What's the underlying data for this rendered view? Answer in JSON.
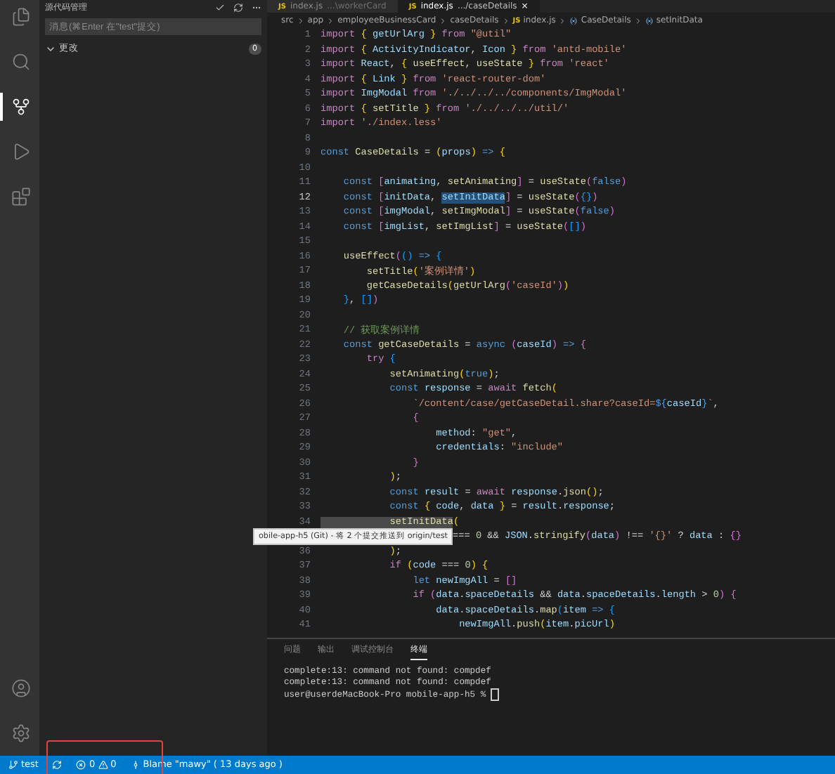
{
  "activity_bar": {
    "items": [
      {
        "kind": "files",
        "selected": false
      },
      {
        "kind": "search",
        "selected": false
      },
      {
        "kind": "scm",
        "selected": true
      },
      {
        "kind": "run",
        "selected": false
      },
      {
        "kind": "extensions",
        "selected": false
      }
    ],
    "bottom": [
      {
        "kind": "account"
      },
      {
        "kind": "settings"
      }
    ]
  },
  "sidebar": {
    "title": "源代码管理",
    "message_placeholder": "消息(⌘Enter 在\"test\"提交)",
    "section": {
      "label": "更改",
      "expanded": true,
      "count": "0"
    }
  },
  "tabs": [
    {
      "badge": "JS",
      "label": "index.js",
      "description": "...\\workerCard",
      "selected": false
    },
    {
      "badge": "JS",
      "label": "index.js",
      "description": ".../caseDetails",
      "selected": true,
      "close": "×"
    }
  ],
  "breadcrumb": [
    {
      "kind": "folder",
      "text": "src"
    },
    {
      "kind": "folder",
      "text": "app"
    },
    {
      "kind": "folder",
      "text": "employeeBusinessCard"
    },
    {
      "kind": "folder",
      "text": "caseDetails"
    },
    {
      "kind": "file",
      "badge": "JS",
      "text": "index.js"
    },
    {
      "kind": "symbol",
      "text": "CaseDetails"
    },
    {
      "kind": "symbol",
      "text": "setInitData"
    }
  ],
  "code": [
    {
      "number": "1",
      "current": false,
      "tokens": [
        {
          "kind": "kw",
          "text": "import "
        },
        {
          "kind": "br1",
          "text": "{ "
        },
        {
          "kind": "var",
          "text": "getUrlArg"
        },
        {
          "kind": "br1",
          "text": " }"
        },
        {
          "kind": "kw",
          "text": " from "
        },
        {
          "kind": "str",
          "text": "\"@util\""
        }
      ]
    },
    {
      "number": "2",
      "current": false,
      "tokens": [
        {
          "kind": "kw",
          "text": "import "
        },
        {
          "kind": "br1",
          "text": "{ "
        },
        {
          "kind": "var",
          "text": "ActivityIndicator"
        },
        {
          "kind": "txt",
          "text": ", "
        },
        {
          "kind": "var",
          "text": "Icon"
        },
        {
          "kind": "br1",
          "text": " }"
        },
        {
          "kind": "kw",
          "text": " from "
        },
        {
          "kind": "str",
          "text": "'antd-mobile'"
        }
      ]
    },
    {
      "number": "3",
      "current": false,
      "tokens": [
        {
          "kind": "kw",
          "text": "import "
        },
        {
          "kind": "var",
          "text": "React"
        },
        {
          "kind": "txt",
          "text": ", "
        },
        {
          "kind": "br1",
          "text": "{ "
        },
        {
          "kind": "fn",
          "text": "useEffect"
        },
        {
          "kind": "txt",
          "text": ", "
        },
        {
          "kind": "fn",
          "text": "useState"
        },
        {
          "kind": "br1",
          "text": " }"
        },
        {
          "kind": "kw",
          "text": " from "
        },
        {
          "kind": "str",
          "text": "'react'"
        }
      ]
    },
    {
      "number": "4",
      "current": false,
      "tokens": [
        {
          "kind": "kw",
          "text": "import "
        },
        {
          "kind": "br1",
          "text": "{ "
        },
        {
          "kind": "var",
          "text": "Link"
        },
        {
          "kind": "br1",
          "text": " }"
        },
        {
          "kind": "kw",
          "text": " from "
        },
        {
          "kind": "str",
          "text": "'react-router-dom'"
        }
      ]
    },
    {
      "number": "5",
      "current": false,
      "tokens": [
        {
          "kind": "kw",
          "text": "import "
        },
        {
          "kind": "var",
          "text": "ImgModal"
        },
        {
          "kind": "kw",
          "text": " from "
        },
        {
          "kind": "str",
          "text": "'./../../../components/ImgModal'"
        }
      ]
    },
    {
      "number": "6",
      "current": false,
      "tokens": [
        {
          "kind": "kw",
          "text": "import "
        },
        {
          "kind": "br1",
          "text": "{ "
        },
        {
          "kind": "fn",
          "text": "setTitle"
        },
        {
          "kind": "br1",
          "text": " }"
        },
        {
          "kind": "kw",
          "text": " from "
        },
        {
          "kind": "str",
          "text": "'./../../../util/'"
        }
      ]
    },
    {
      "number": "7",
      "current": false,
      "tokens": [
        {
          "kind": "kw",
          "text": "import "
        },
        {
          "kind": "str",
          "text": "'./index.less'"
        }
      ]
    },
    {
      "number": "8",
      "current": false
    },
    {
      "number": "9",
      "current": false,
      "tokens": [
        {
          "kind": "decl",
          "text": "const "
        },
        {
          "kind": "fn",
          "text": "CaseDetails"
        },
        {
          "kind": "txt",
          "text": " = "
        },
        {
          "kind": "br1",
          "text": "("
        },
        {
          "kind": "var",
          "text": "props"
        },
        {
          "kind": "br1",
          "text": ")"
        },
        {
          "kind": "decl",
          "text": " => "
        },
        {
          "kind": "br1",
          "text": "{"
        }
      ]
    },
    {
      "number": "10",
      "current": false
    },
    {
      "number": "11",
      "current": false,
      "tokens": [
        {
          "kind": "decl",
          "text": "    const "
        },
        {
          "kind": "br2",
          "text": "["
        },
        {
          "kind": "var",
          "text": "animating"
        },
        {
          "kind": "txt",
          "text": ", "
        },
        {
          "kind": "fn",
          "text": "setAnimating"
        },
        {
          "kind": "br2",
          "text": "]"
        },
        {
          "kind": "txt",
          "text": " = "
        },
        {
          "kind": "fn",
          "text": "useState"
        },
        {
          "kind": "br2",
          "text": "("
        },
        {
          "kind": "decl",
          "text": "false"
        },
        {
          "kind": "br2",
          "text": ")"
        }
      ]
    },
    {
      "number": "12",
      "current": true,
      "tokens": [
        {
          "kind": "decl",
          "text": "    const "
        },
        {
          "kind": "br2",
          "text": "["
        },
        {
          "kind": "var",
          "text": "initData"
        },
        {
          "kind": "txt",
          "text": ", "
        },
        {
          "kind": "sel",
          "text": "setInitData"
        },
        {
          "kind": "br2",
          "text": "]"
        },
        {
          "kind": "txt",
          "text": " = "
        },
        {
          "kind": "fn",
          "text": "useState"
        },
        {
          "kind": "br2",
          "text": "("
        },
        {
          "kind": "br3",
          "text": "{}"
        },
        {
          "kind": "br2",
          "text": ")"
        }
      ]
    },
    {
      "number": "13",
      "current": false,
      "tokens": [
        {
          "kind": "decl",
          "text": "    const "
        },
        {
          "kind": "br2",
          "text": "["
        },
        {
          "kind": "var",
          "text": "imgModal"
        },
        {
          "kind": "txt",
          "text": ", "
        },
        {
          "kind": "fn",
          "text": "setImgModal"
        },
        {
          "kind": "br2",
          "text": "]"
        },
        {
          "kind": "txt",
          "text": " = "
        },
        {
          "kind": "fn",
          "text": "useState"
        },
        {
          "kind": "br2",
          "text": "("
        },
        {
          "kind": "decl",
          "text": "false"
        },
        {
          "kind": "br2",
          "text": ")"
        }
      ]
    },
    {
      "number": "14",
      "current": false,
      "tokens": [
        {
          "kind": "decl",
          "text": "    const "
        },
        {
          "kind": "br2",
          "text": "["
        },
        {
          "kind": "var",
          "text": "imgList"
        },
        {
          "kind": "txt",
          "text": ", "
        },
        {
          "kind": "fn",
          "text": "setImgList"
        },
        {
          "kind": "br2",
          "text": "]"
        },
        {
          "kind": "txt",
          "text": " = "
        },
        {
          "kind": "fn",
          "text": "useState"
        },
        {
          "kind": "br2",
          "text": "("
        },
        {
          "kind": "br3",
          "text": "[]"
        },
        {
          "kind": "br2",
          "text": ")"
        }
      ]
    },
    {
      "number": "15",
      "current": false
    },
    {
      "number": "16",
      "current": false,
      "tokens": [
        {
          "kind": "fn",
          "text": "    useEffect"
        },
        {
          "kind": "br2",
          "text": "("
        },
        {
          "kind": "br3",
          "text": "()"
        },
        {
          "kind": "decl",
          "text": " => "
        },
        {
          "kind": "br3",
          "text": "{"
        }
      ]
    },
    {
      "number": "17",
      "current": false,
      "tokens": [
        {
          "kind": "fn",
          "text": "        setTitle"
        },
        {
          "kind": "br1",
          "text": "("
        },
        {
          "kind": "str",
          "text": "'案例详情'"
        },
        {
          "kind": "br1",
          "text": ")"
        }
      ]
    },
    {
      "number": "18",
      "current": false,
      "tokens": [
        {
          "kind": "fn",
          "text": "        getCaseDetails"
        },
        {
          "kind": "br1",
          "text": "("
        },
        {
          "kind": "fn",
          "text": "getUrlArg"
        },
        {
          "kind": "br2",
          "text": "("
        },
        {
          "kind": "str",
          "text": "'caseId'"
        },
        {
          "kind": "br2",
          "text": ")"
        },
        {
          "kind": "br1",
          "text": ")"
        }
      ]
    },
    {
      "number": "19",
      "current": false,
      "tokens": [
        {
          "kind": "br3",
          "text": "    }"
        },
        {
          "kind": "txt",
          "text": ", "
        },
        {
          "kind": "br3",
          "text": "[]"
        },
        {
          "kind": "br2",
          "text": ")"
        }
      ]
    },
    {
      "number": "20",
      "current": false
    },
    {
      "number": "21",
      "current": false,
      "tokens": [
        {
          "kind": "cm",
          "text": "    // 获取案例详情"
        }
      ]
    },
    {
      "number": "22",
      "current": false,
      "tokens": [
        {
          "kind": "decl",
          "text": "    const "
        },
        {
          "kind": "fn",
          "text": "getCaseDetails"
        },
        {
          "kind": "txt",
          "text": " = "
        },
        {
          "kind": "decl",
          "text": "async "
        },
        {
          "kind": "br2",
          "text": "("
        },
        {
          "kind": "var",
          "text": "caseId"
        },
        {
          "kind": "br2",
          "text": ")"
        },
        {
          "kind": "decl",
          "text": " => "
        },
        {
          "kind": "br2",
          "text": "{"
        }
      ]
    },
    {
      "number": "23",
      "current": false,
      "tokens": [
        {
          "kind": "kw",
          "text": "        try "
        },
        {
          "kind": "br3",
          "text": "{"
        }
      ]
    },
    {
      "number": "24",
      "current": false,
      "tokens": [
        {
          "kind": "fn",
          "text": "            setAnimating"
        },
        {
          "kind": "br1",
          "text": "("
        },
        {
          "kind": "decl",
          "text": "true"
        },
        {
          "kind": "br1",
          "text": ")"
        },
        {
          "kind": "txt",
          "text": ";"
        }
      ]
    },
    {
      "number": "25",
      "current": false,
      "tokens": [
        {
          "kind": "decl",
          "text": "            const "
        },
        {
          "kind": "var",
          "text": "response"
        },
        {
          "kind": "txt",
          "text": " = "
        },
        {
          "kind": "kw",
          "text": "await "
        },
        {
          "kind": "fn",
          "text": "fetch"
        },
        {
          "kind": "br1",
          "text": "("
        }
      ]
    },
    {
      "number": "26",
      "current": false,
      "tokens": [
        {
          "kind": "str",
          "text": "                `/content/case/getCaseDetail.share?caseId="
        },
        {
          "kind": "decl",
          "text": "${"
        },
        {
          "kind": "var",
          "text": "caseId"
        },
        {
          "kind": "decl",
          "text": "}"
        },
        {
          "kind": "str",
          "text": "`"
        },
        {
          "kind": "txt",
          "text": ","
        }
      ]
    },
    {
      "number": "27",
      "current": false,
      "tokens": [
        {
          "kind": "br2",
          "text": "                {"
        }
      ]
    },
    {
      "number": "28",
      "current": false,
      "tokens": [
        {
          "kind": "var",
          "text": "                    method"
        },
        {
          "kind": "txt",
          "text": ": "
        },
        {
          "kind": "str",
          "text": "\"get\""
        },
        {
          "kind": "txt",
          "text": ","
        }
      ]
    },
    {
      "number": "29",
      "current": false,
      "tokens": [
        {
          "kind": "var",
          "text": "                    credentials"
        },
        {
          "kind": "txt",
          "text": ": "
        },
        {
          "kind": "str",
          "text": "\"include\""
        }
      ]
    },
    {
      "number": "30",
      "current": false,
      "tokens": [
        {
          "kind": "br2",
          "text": "                }"
        }
      ]
    },
    {
      "number": "31",
      "current": false,
      "tokens": [
        {
          "kind": "br1",
          "text": "            )"
        },
        {
          "kind": "txt",
          "text": ";"
        }
      ]
    },
    {
      "number": "32",
      "current": false,
      "tokens": [
        {
          "kind": "decl",
          "text": "            const "
        },
        {
          "kind": "var",
          "text": "result"
        },
        {
          "kind": "txt",
          "text": " = "
        },
        {
          "kind": "kw",
          "text": "await "
        },
        {
          "kind": "var",
          "text": "response"
        },
        {
          "kind": "txt",
          "text": "."
        },
        {
          "kind": "fn",
          "text": "json"
        },
        {
          "kind": "br1",
          "text": "()"
        },
        {
          "kind": "txt",
          "text": ";"
        }
      ]
    },
    {
      "number": "33",
      "current": false,
      "tokens": [
        {
          "kind": "decl",
          "text": "            const "
        },
        {
          "kind": "br1",
          "text": "{ "
        },
        {
          "kind": "var",
          "text": "code"
        },
        {
          "kind": "txt",
          "text": ", "
        },
        {
          "kind": "var",
          "text": "data"
        },
        {
          "kind": "br1",
          "text": " }"
        },
        {
          "kind": "txt",
          "text": " = "
        },
        {
          "kind": "var",
          "text": "result"
        },
        {
          "kind": "txt",
          "text": "."
        },
        {
          "kind": "var",
          "text": "response"
        },
        {
          "kind": "txt",
          "text": ";"
        }
      ]
    },
    {
      "number": "34",
      "current": false,
      "tokens": [
        {
          "kind": "match",
          "text": "            setInitData"
        },
        {
          "kind": "br1",
          "text": "("
        }
      ]
    },
    {
      "tokens": [
        {
          "kind": "txt",
          "text": "=== "
        },
        {
          "kind": "num",
          "text": "0"
        },
        {
          "kind": "txt",
          "text": " && "
        },
        {
          "kind": "var",
          "text": "JSON"
        },
        {
          "kind": "txt",
          "text": "."
        },
        {
          "kind": "fn",
          "text": "stringify"
        },
        {
          "kind": "br2",
          "text": "("
        },
        {
          "kind": "var",
          "text": "data"
        },
        {
          "kind": "br2",
          "text": ")"
        },
        {
          "kind": "txt",
          "text": " !== "
        },
        {
          "kind": "str",
          "text": "'{}'"
        },
        {
          "kind": "txt",
          "text": " ? "
        },
        {
          "kind": "var",
          "text": "data"
        },
        {
          "kind": "txt",
          "text": " : "
        },
        {
          "kind": "br2",
          "text": "{}"
        }
      ]
    },
    {
      "number": "36",
      "current": false,
      "tokens": [
        {
          "kind": "br1",
          "text": "            )"
        },
        {
          "kind": "txt",
          "text": ";"
        }
      ]
    },
    {
      "number": "37",
      "current": false,
      "tokens": [
        {
          "kind": "kw",
          "text": "            if "
        },
        {
          "kind": "br1",
          "text": "("
        },
        {
          "kind": "var",
          "text": "code"
        },
        {
          "kind": "txt",
          "text": " === "
        },
        {
          "kind": "num",
          "text": "0"
        },
        {
          "kind": "br1",
          "text": ")"
        },
        {
          "kind": "br1",
          "text": " {"
        }
      ]
    },
    {
      "number": "38",
      "current": false,
      "tokens": [
        {
          "kind": "decl",
          "text": "                let "
        },
        {
          "kind": "var",
          "text": "newImgAll"
        },
        {
          "kind": "txt",
          "text": " = "
        },
        {
          "kind": "br2",
          "text": "[]"
        }
      ]
    },
    {
      "number": "39",
      "current": false,
      "tokens": [
        {
          "kind": "kw",
          "text": "                if "
        },
        {
          "kind": "br2",
          "text": "("
        },
        {
          "kind": "var",
          "text": "data"
        },
        {
          "kind": "txt",
          "text": "."
        },
        {
          "kind": "var",
          "text": "spaceDetails"
        },
        {
          "kind": "txt",
          "text": " && "
        },
        {
          "kind": "var",
          "text": "data"
        },
        {
          "kind": "txt",
          "text": "."
        },
        {
          "kind": "var",
          "text": "spaceDetails"
        },
        {
          "kind": "txt",
          "text": "."
        },
        {
          "kind": "var",
          "text": "length"
        },
        {
          "kind": "txt",
          "text": " > "
        },
        {
          "kind": "num",
          "text": "0"
        },
        {
          "kind": "br2",
          "text": ")"
        },
        {
          "kind": "br2",
          "text": " {"
        }
      ]
    },
    {
      "number": "40",
      "current": false,
      "tokens": [
        {
          "kind": "var",
          "text": "                    data"
        },
        {
          "kind": "txt",
          "text": "."
        },
        {
          "kind": "var",
          "text": "spaceDetails"
        },
        {
          "kind": "txt",
          "text": "."
        },
        {
          "kind": "fn",
          "text": "map"
        },
        {
          "kind": "br3",
          "text": "("
        },
        {
          "kind": "var",
          "text": "item"
        },
        {
          "kind": "decl",
          "text": " => "
        },
        {
          "kind": "br3",
          "text": "{"
        }
      ]
    },
    {
      "number": "41",
      "current": false,
      "tokens": [
        {
          "kind": "var",
          "text": "                        newImgAll"
        },
        {
          "kind": "txt",
          "text": "."
        },
        {
          "kind": "fn",
          "text": "push"
        },
        {
          "kind": "br1",
          "text": "("
        },
        {
          "kind": "var",
          "text": "item"
        },
        {
          "kind": "txt",
          "text": "."
        },
        {
          "kind": "var",
          "text": "picUrl"
        },
        {
          "kind": "br1",
          "text": ")"
        }
      ]
    }
  ],
  "tooltip": {
    "text": "obile-app-h5 (Git) - 将 2 个提交推送到 origin/test"
  },
  "panel": {
    "tabs": [
      {
        "label": "问题",
        "selected": false
      },
      {
        "label": "输出",
        "selected": false
      },
      {
        "label": "调试控制台",
        "selected": false
      },
      {
        "label": "终端",
        "selected": true
      }
    ],
    "terminal": [
      "complete:13: command not found: compdef",
      "complete:13: command not found: compdef",
      "user@userdeMacBook-Pro mobile-app-h5 % "
    ]
  },
  "status_bar": {
    "branch": "test",
    "errors": "0",
    "warnings": "0",
    "blame": "Blame \"mawy\" ( 13 days ago )"
  },
  "annotation": {
    "color": "#e0443a"
  }
}
